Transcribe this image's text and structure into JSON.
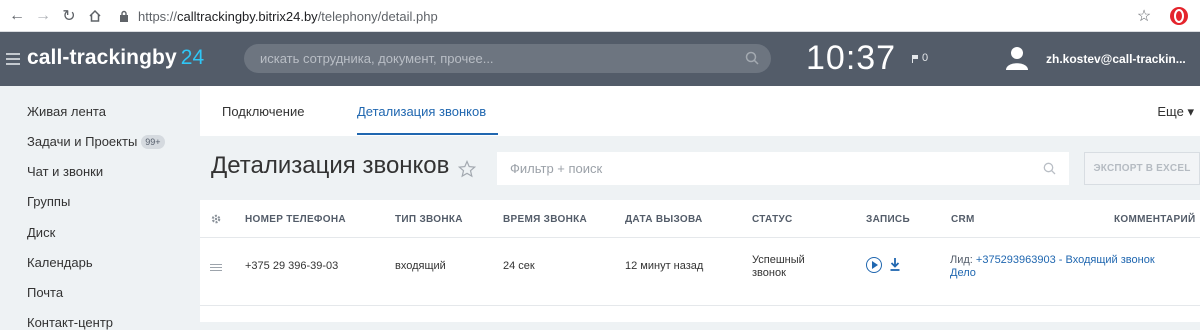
{
  "browser": {
    "url_scheme": "https://",
    "url_host": "calltrackingby.bitrix24.by",
    "url_path": "/telephony/detail.php"
  },
  "header": {
    "logo_text": "call-trackingby",
    "logo_num": "24",
    "search_placeholder": "искать сотрудника, документ, прочее...",
    "clock": "10:37",
    "flag_count": "0",
    "user": "zh.kostev@call-trackin..."
  },
  "sidebar": {
    "items": [
      {
        "label": "Живая лента"
      },
      {
        "label": "Задачи и Проекты",
        "badge": "99+"
      },
      {
        "label": "Чат и звонки"
      },
      {
        "label": "Группы"
      },
      {
        "label": "Диск"
      },
      {
        "label": "Календарь"
      },
      {
        "label": "Почта"
      },
      {
        "label": "Контакт-центр"
      }
    ]
  },
  "main": {
    "tabs": [
      {
        "label": "Подключение"
      },
      {
        "label": "Детализация звонков",
        "active": true
      }
    ],
    "more_label": "Еще",
    "page_title": "Детализация звонков",
    "filter_placeholder": "Фильтр + поиск",
    "export_label": "ЭКСПОРТ В EXCEL"
  },
  "table": {
    "columns": [
      "НОМЕР ТЕЛЕФОНА",
      "ТИП ЗВОНКА",
      "ВРЕМЯ ЗВОНКА",
      "ДАТА ВЫЗОВА",
      "СТАТУС",
      "ЗАПИСЬ",
      "CRM",
      "КОММЕНТАРИЙ"
    ],
    "rows": [
      {
        "phone": "+375 29 396-39-03",
        "type": "входящий",
        "duration": "24 сек",
        "date": "12 минут назад",
        "status": "Успешный звонок",
        "crm_label": "Лид:",
        "crm_link": "+375293963903 - Входящий звонок",
        "crm_case": "Дело"
      }
    ]
  },
  "colors": {
    "header_bg": "#535c69",
    "accent": "#2067b0",
    "logo_accent": "#2fc6f6",
    "page_bg": "#eef2f4"
  }
}
